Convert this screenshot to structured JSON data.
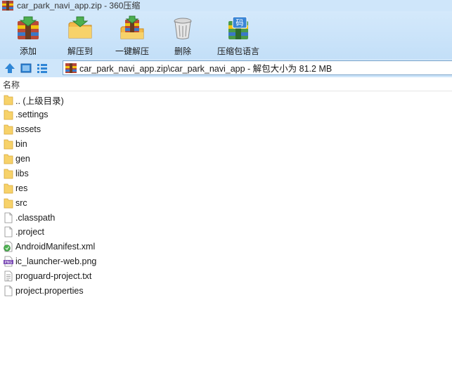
{
  "window": {
    "title": "car_park_navi_app.zip - 360压缩"
  },
  "toolbar": {
    "buttons": [
      {
        "label": "添加",
        "icon": "add-archive-icon"
      },
      {
        "label": "解压到",
        "icon": "extract-folder-icon"
      },
      {
        "label": "一键解压",
        "icon": "one-click-extract-icon"
      },
      {
        "label": "删除",
        "icon": "trash-icon"
      },
      {
        "label": "压缩包语言",
        "icon": "archive-language-icon"
      }
    ]
  },
  "addressbar": {
    "path": "car_park_navi_app.zip\\car_park_navi_app - 解包大小为 81.2 MB"
  },
  "columns": {
    "name": "名称"
  },
  "files": [
    {
      "name": ".. (上级目录)",
      "type": "folder"
    },
    {
      "name": ".settings",
      "type": "folder"
    },
    {
      "name": "assets",
      "type": "folder"
    },
    {
      "name": "bin",
      "type": "folder"
    },
    {
      "name": "gen",
      "type": "folder"
    },
    {
      "name": "libs",
      "type": "folder"
    },
    {
      "name": "res",
      "type": "folder"
    },
    {
      "name": "src",
      "type": "folder"
    },
    {
      "name": ".classpath",
      "type": "file"
    },
    {
      "name": ".project",
      "type": "file"
    },
    {
      "name": "AndroidManifest.xml",
      "type": "xml"
    },
    {
      "name": "ic_launcher-web.png",
      "type": "png"
    },
    {
      "name": "proguard-project.txt",
      "type": "txt"
    },
    {
      "name": "project.properties",
      "type": "file"
    }
  ],
  "colors": {
    "chrome": "#cfe6fa",
    "folder": "#f7d26a",
    "accent": "#2f86d6"
  }
}
